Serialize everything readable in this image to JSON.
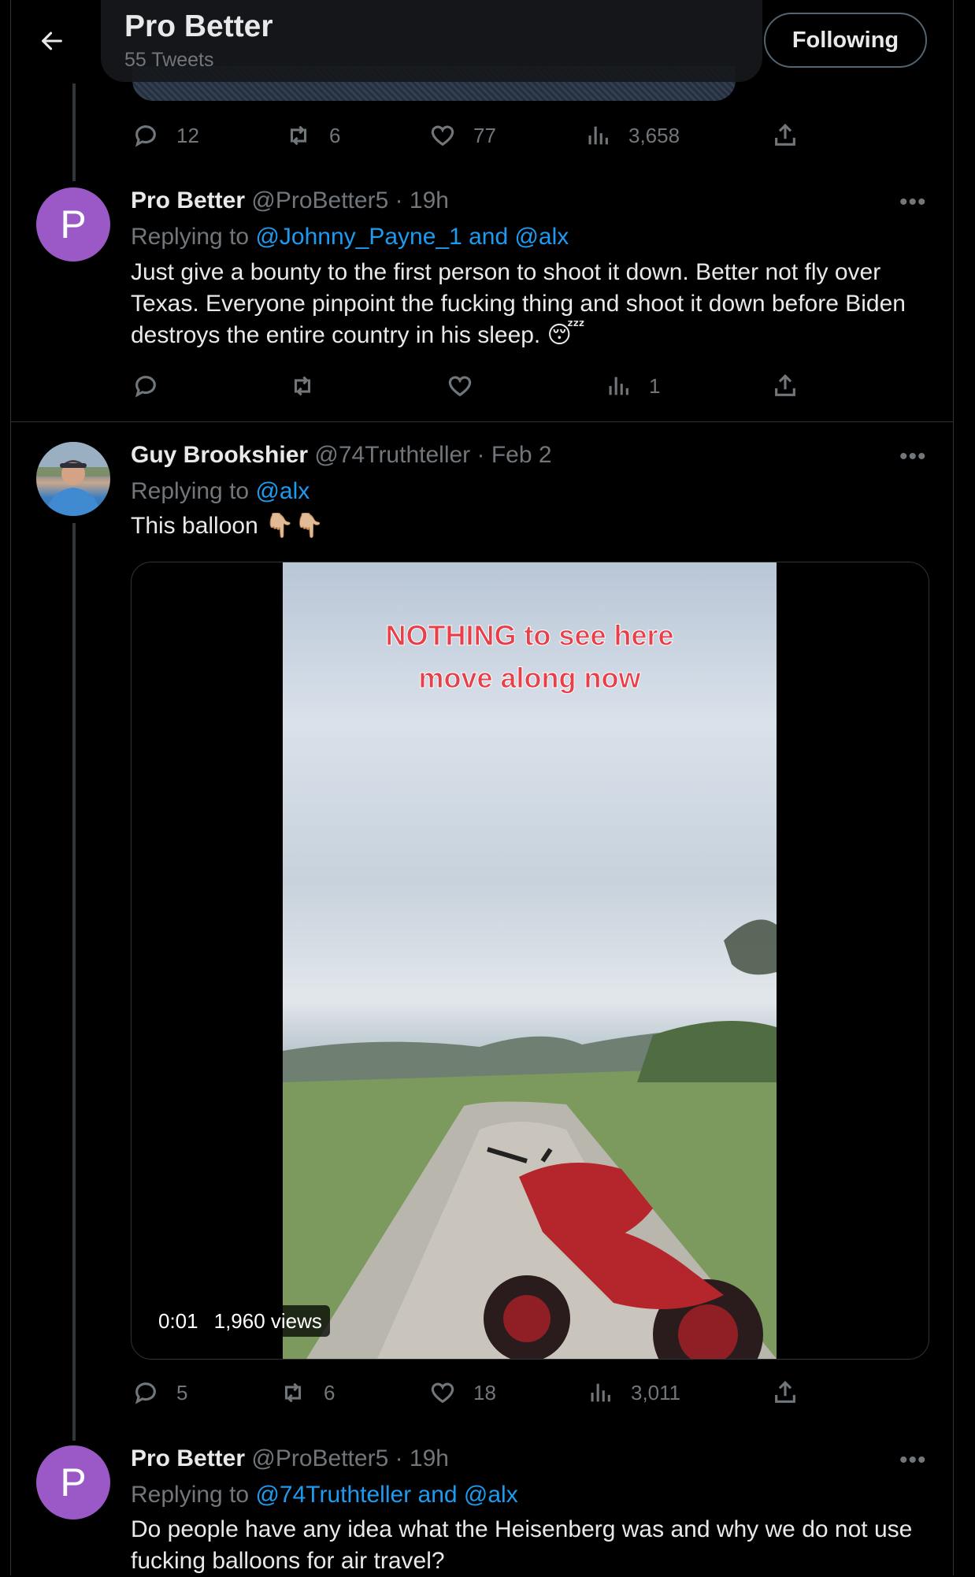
{
  "header": {
    "title": "Pro Better",
    "subtitle": "55 Tweets",
    "follow_label": "Following"
  },
  "top_actions": {
    "replies": "12",
    "retweets": "6",
    "likes": "77",
    "views": "3,658"
  },
  "tweets": [
    {
      "name": "Pro Better",
      "meta": "@ProBetter5 · 19h",
      "avatar_letter": "P",
      "replying_prefix": "Replying to",
      "replying_to": "@Johnny_Payne_1 and @alx",
      "text": "Just give a bounty to the first person to shoot it down.  Better not fly over Texas.  Everyone pinpoint the fucking thing and shoot it down before Biden destroys the entire country in his sleep. 😴",
      "actions": {
        "replies": "",
        "retweets": "",
        "likes": "",
        "views": "1"
      }
    },
    {
      "name": "Guy Brookshier",
      "meta": "@74Truthteller · Feb 2",
      "replying_prefix": "Replying to",
      "replying_to": "@alx",
      "text": "This balloon 👇🏼👇🏼",
      "video": {
        "overlay_line1": "NOTHING to see here",
        "overlay_line2": "move along now",
        "time": "0:01",
        "views": "1,960 views"
      },
      "actions": {
        "replies": "5",
        "retweets": "6",
        "likes": "18",
        "views": "3,011"
      }
    },
    {
      "name": "Pro Better",
      "meta": "@ProBetter5 · 19h",
      "avatar_letter": "P",
      "replying_prefix": "Replying to",
      "replying_to": "@74Truthteller and @alx",
      "text": "Do people have any idea what the Heisenberg was and why we do not use fucking balloons for air travel?"
    }
  ],
  "colors": {
    "background": "#000000",
    "text": "#e7e9ea",
    "muted": "#71767b",
    "link": "#1d9bf0",
    "avatar": "#9b59c8"
  },
  "icons": [
    "back-arrow-icon",
    "reply-icon",
    "retweet-icon",
    "like-icon",
    "views-icon",
    "share-icon",
    "more-icon"
  ]
}
